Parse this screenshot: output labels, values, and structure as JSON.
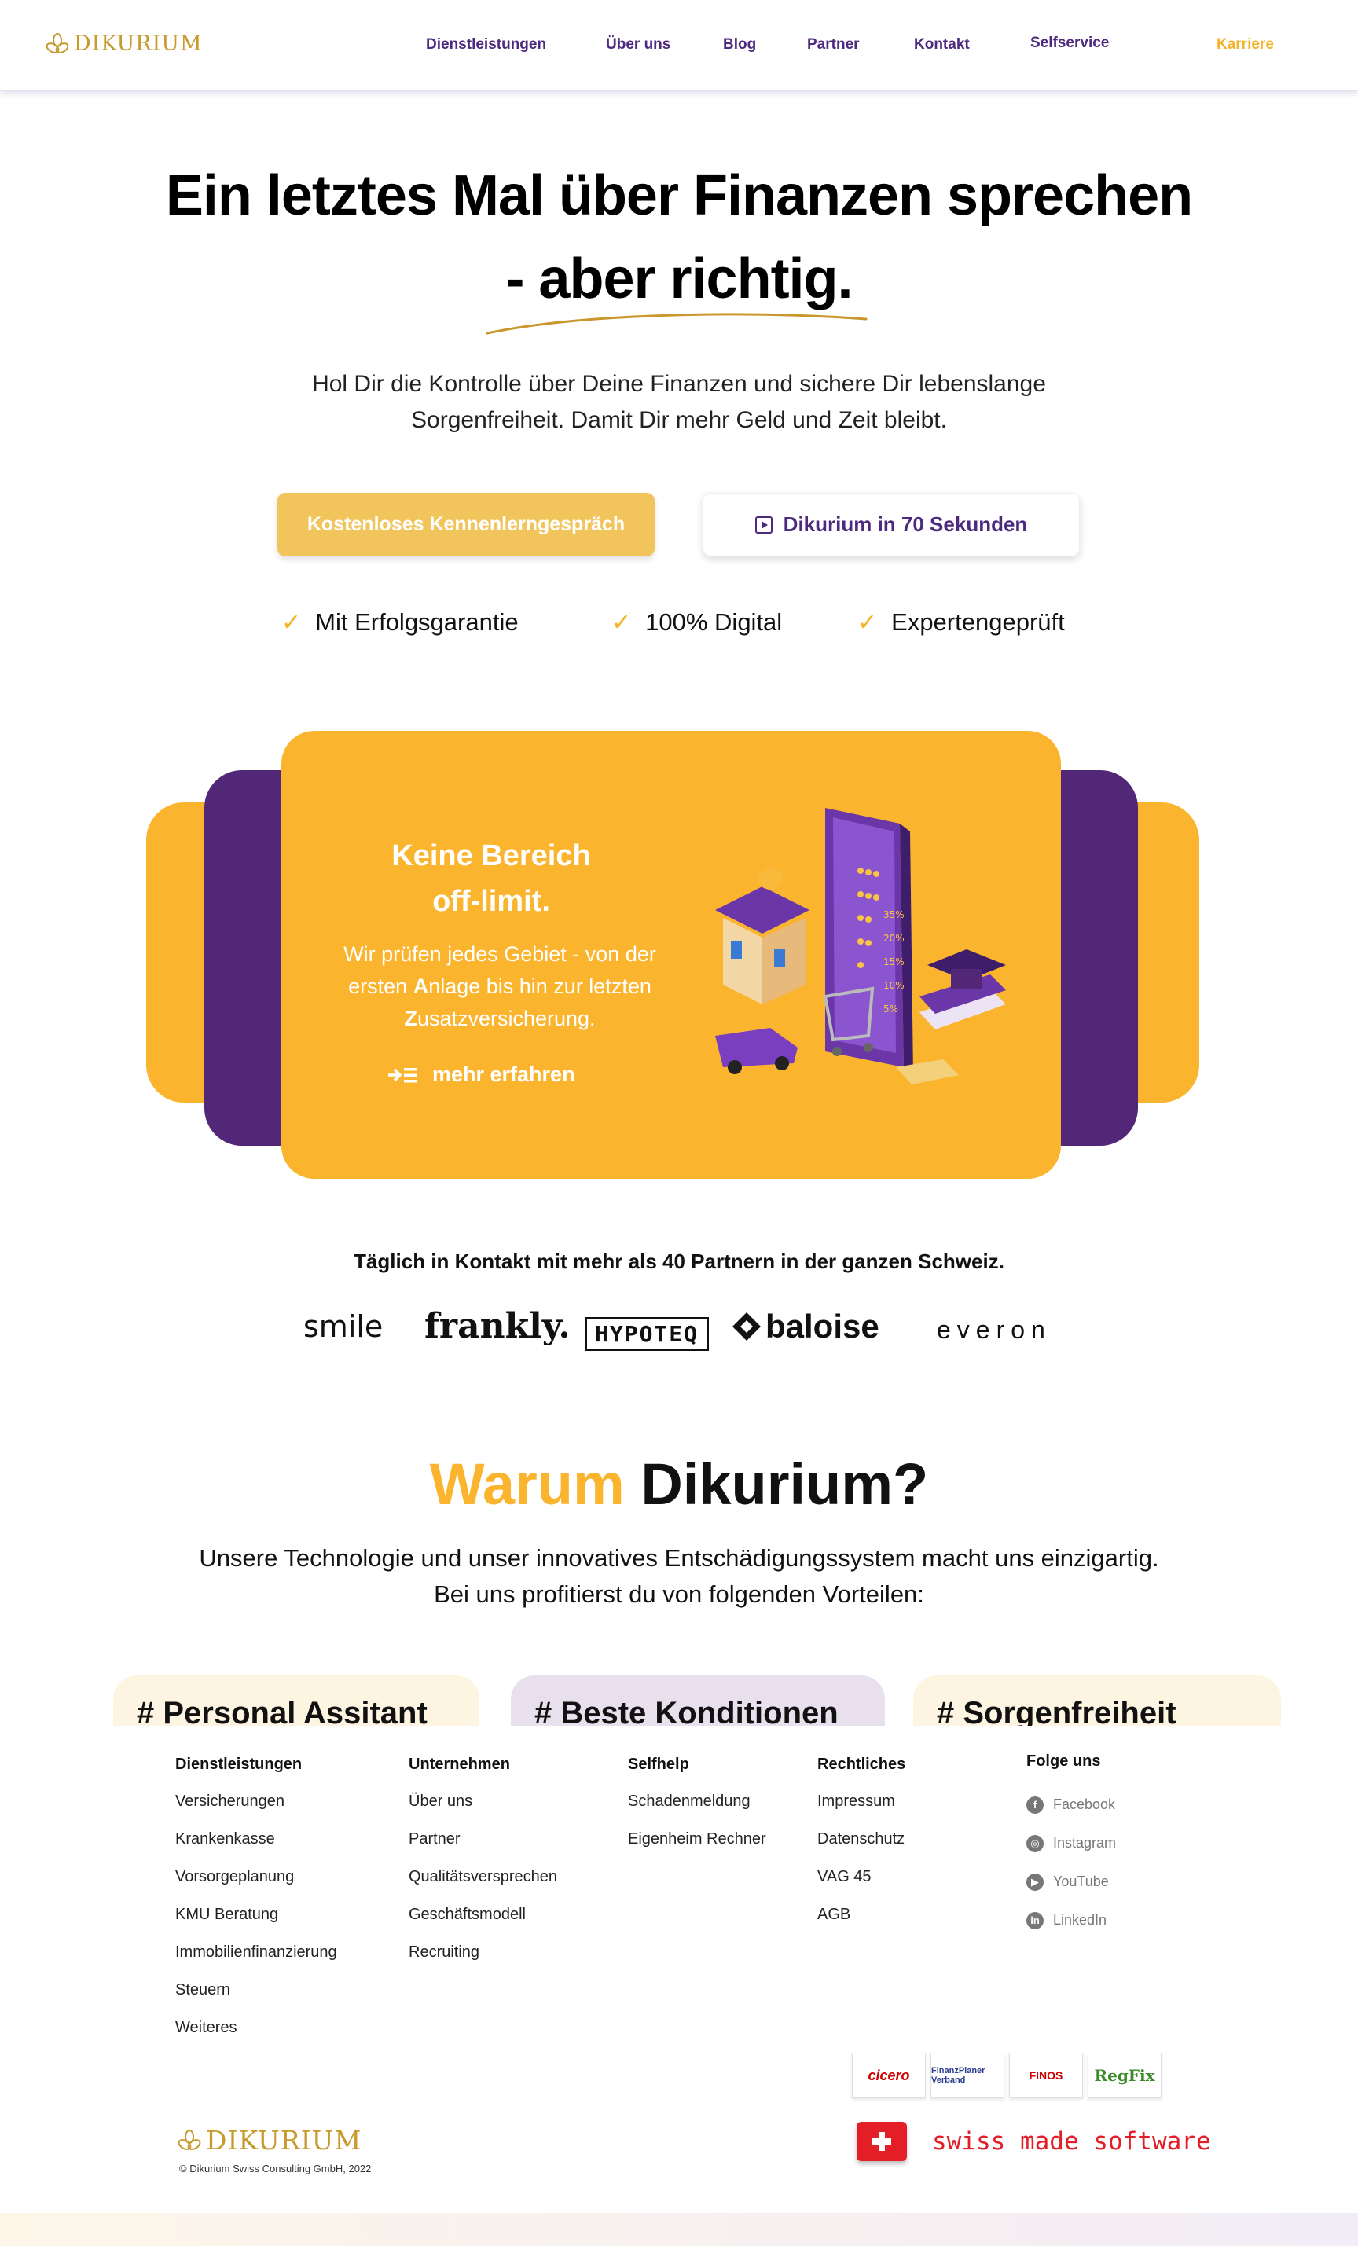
{
  "brand": {
    "name": "DIKURIUM",
    "color": "#c69a2c"
  },
  "nav": {
    "links": [
      "Dienstleistungen",
      "Über uns",
      "Blog",
      "Partner",
      "Kontakt",
      "Selfservice"
    ],
    "career": "Karriere"
  },
  "hero": {
    "title_line1": "Ein letztes Mal über Finanzen sprechen",
    "title_line2": "- aber richtig.",
    "subtitle": "Hol Dir die Kontrolle über Deine Finanzen und sichere Dir lebenslange Sorgenfreiheit. Damit Dir mehr Geld und Zeit bleibt.",
    "cta_primary": "Kostenloses Kennenlerngespräch",
    "cta_secondary": "Dikurium in 70 Sekunden",
    "usps": [
      "Mit Erfolgsgarantie",
      "100% Digital",
      "Expertengeprüft"
    ]
  },
  "feature_card": {
    "title_line1": "Keine Bereich",
    "title_line2": "off-limit.",
    "text_a": "Wir prüfen jedes Gebiet - von der ersten ",
    "text_b": "A",
    "text_c": "nlage bis hin zur letzten ",
    "text_d": "Z",
    "text_e": "usatzversicherung.",
    "link": "mehr erfahren",
    "illustration_percentages": [
      "35%",
      "20%",
      "15%",
      "10%",
      "5%"
    ]
  },
  "partners": {
    "title": "Täglich in Kontakt mit mehr als 40 Partnern in der ganzen Schweiz.",
    "logos": [
      "smile",
      "frankly.",
      "HYPOTEQ",
      "baloise",
      "everon"
    ]
  },
  "why": {
    "title_accent": "Warum",
    "title_rest": " Dikurium?",
    "subtitle": "Unsere Technologie und unser innovatives Entschädigungssystem macht uns einzigartig. Bei uns profitierst du von folgenden Vorteilen:",
    "tabs": [
      "# Personal Assitant",
      "# Beste Konditionen",
      "# Sorgenfreiheit"
    ]
  },
  "footer": {
    "columns": [
      {
        "heading": "Dienstleistungen",
        "items": [
          "Versicherungen",
          "Krankenkasse",
          "Vorsorgeplanung",
          "KMU Beratung",
          "Immobilienfinanzierung",
          "Steuern",
          "Weiteres"
        ]
      },
      {
        "heading": "Unternehmen",
        "items": [
          "Über uns",
          "Partner",
          "Qualitätsversprechen",
          "Geschäftsmodell",
          "Recruiting"
        ]
      },
      {
        "heading": "Selfhelp",
        "items": [
          "Schadenmeldung",
          "Eigenheim Rechner"
        ]
      },
      {
        "heading": "Rechtliches",
        "items": [
          "Impressum",
          "Datenschutz",
          "VAG 45",
          "AGB"
        ]
      }
    ],
    "social": {
      "heading": "Folge uns",
      "items": [
        {
          "label": "Facebook",
          "icon": "facebook-icon"
        },
        {
          "label": "Instagram",
          "icon": "instagram-icon"
        },
        {
          "label": "YouTube",
          "icon": "youtube-icon"
        },
        {
          "label": "LinkedIn",
          "icon": "linkedin-icon"
        }
      ]
    },
    "badges": [
      "cicero",
      "FinanzPlaner Verband",
      "FINOS",
      "RegFix"
    ],
    "swiss_made": "swiss made software",
    "copyright": "© Dikurium Swiss Consulting GmbH, 2022"
  },
  "colors": {
    "accent": "#fbb42e",
    "purple": "#532777",
    "nav_text": "#4d2a7e",
    "button_yellow": "#f2c55c"
  }
}
